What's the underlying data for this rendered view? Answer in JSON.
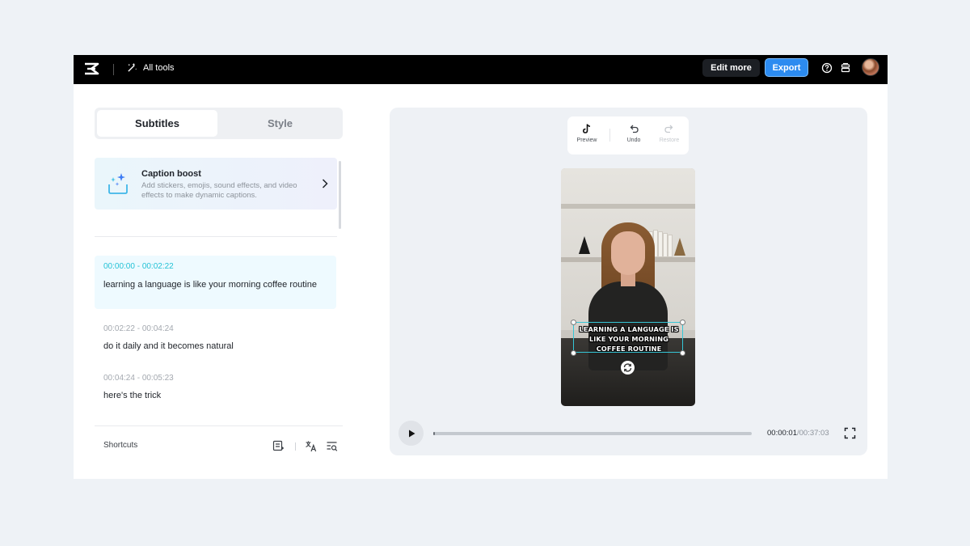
{
  "topbar": {
    "all_tools_label": "All tools",
    "edit_more_label": "Edit more",
    "export_label": "Export"
  },
  "tabs": [
    {
      "label": "Subtitles",
      "active": true
    },
    {
      "label": "Style",
      "active": false
    }
  ],
  "caption_boost": {
    "title": "Caption boost",
    "description": "Add stickers, emojis, sound effects, and video effects to make dynamic captions."
  },
  "subtitles": [
    {
      "time": "00:00:00 - 00:02:22",
      "text": "learning a language is like your morning coffee routine",
      "active": true
    },
    {
      "time": "00:02:22 - 00:04:24",
      "text": "do it daily and it becomes natural",
      "active": false
    },
    {
      "time": "00:04:24 - 00:05:23",
      "text": "here's the trick",
      "active": false
    }
  ],
  "footer": {
    "shortcuts_label": "Shortcuts"
  },
  "preview_toolbar": {
    "preview_label": "Preview",
    "undo_label": "Undo",
    "restore_label": "Restore"
  },
  "video": {
    "caption_lines": [
      "LEARNING A LANGUAGE IS",
      "LIKE YOUR MORNING",
      "COFFEE ROUTINE"
    ]
  },
  "player": {
    "current_time": "00:00:01",
    "total_time": "/00:37:03",
    "progress": 0.0045
  },
  "colors": {
    "accent": "#2c8bf0",
    "active_time": "#23c2d6",
    "topbar": "#000000"
  }
}
